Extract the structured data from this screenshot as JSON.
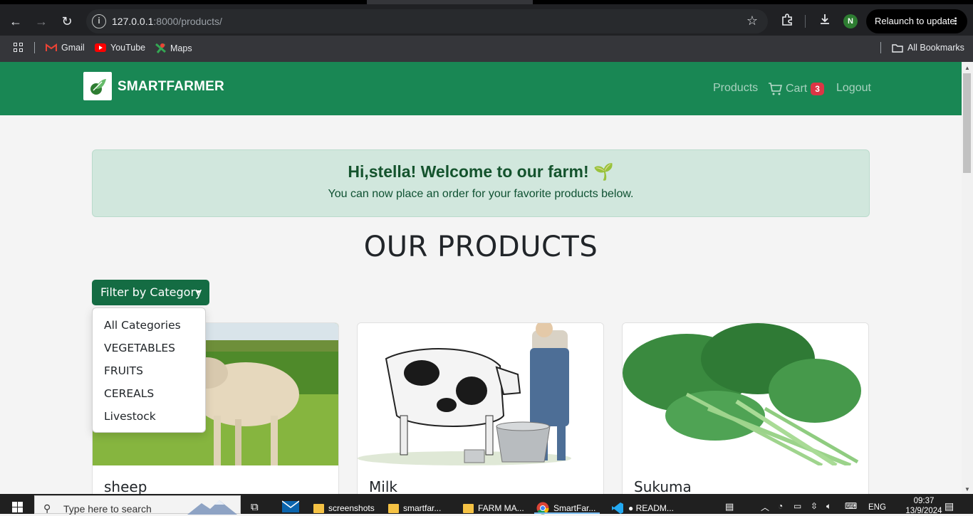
{
  "browser": {
    "url_host": "127.0.0.1",
    "url_path": ":8000/products/",
    "relaunch_label": "Relaunch to update",
    "profile_initial": "N",
    "bookmarks": [
      "Gmail",
      "YouTube",
      "Maps"
    ],
    "all_bookmarks_label": "All Bookmarks"
  },
  "navbar": {
    "brand": "SMARTFARMER",
    "products_label": "Products",
    "cart_label": "Cart",
    "cart_count": "3",
    "logout_label": "Logout"
  },
  "welcome": {
    "heading": "Hi,stella! Welcome to our farm! 🌱",
    "subtext": "You can now place an order for your favorite products below."
  },
  "section_title": "OUR PRODUCTS",
  "filter": {
    "button_label": "Filter by Category",
    "options": [
      "All Categories",
      "VEGETABLES",
      "FRUITS",
      "CEREALS",
      "Livestock"
    ]
  },
  "products": [
    {
      "name": "sheep"
    },
    {
      "name": "Milk"
    },
    {
      "name": "Sukuma"
    }
  ],
  "taskbar": {
    "search_placeholder": "Type here to search",
    "apps": [
      "screenshots",
      "smartfar...",
      "FARM MA...",
      "SmartFar...",
      "● READM..."
    ],
    "language": "ENG",
    "time": "09:37",
    "date": "13/9/2024"
  },
  "colors": {
    "navbar": "#198754",
    "filter_button": "#146c43",
    "welcome_bg": "#d1e7dd",
    "cart_badge": "#dc3545"
  }
}
